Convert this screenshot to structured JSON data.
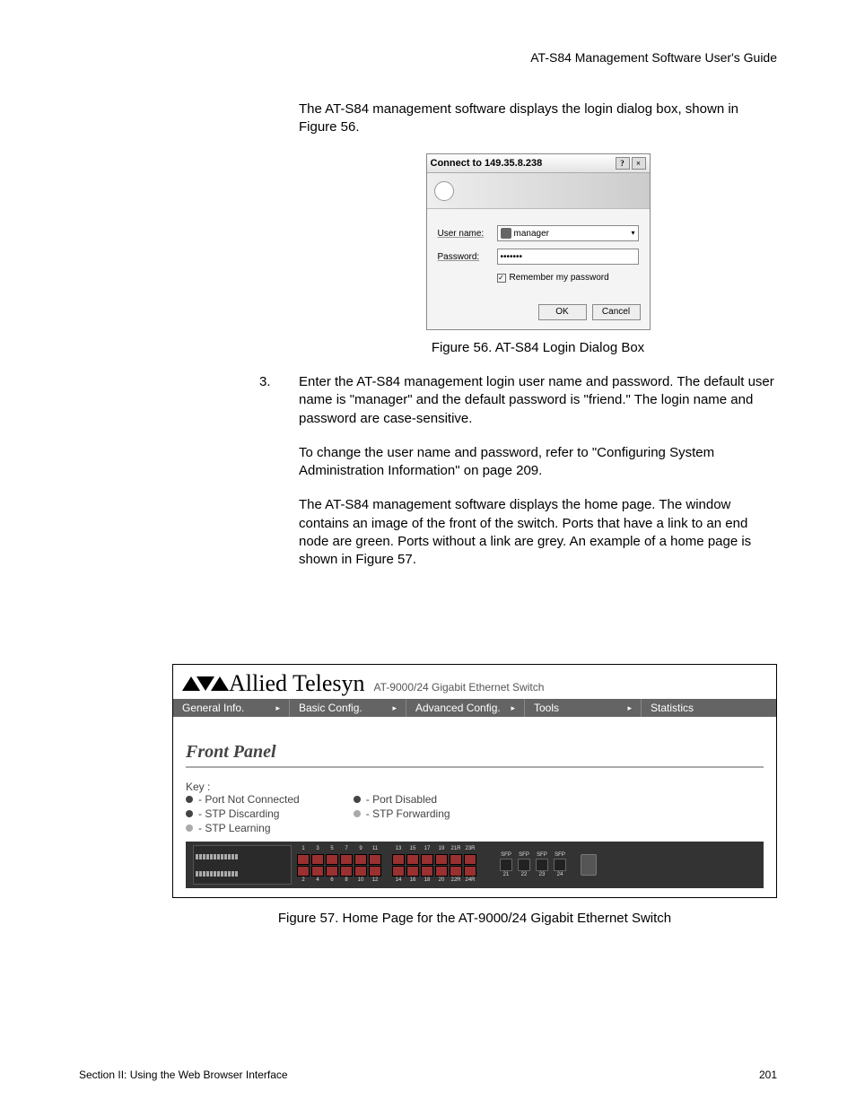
{
  "header": "AT-S84 Management Software User's Guide",
  "intro_para": "The AT-S84 management software displays the login dialog box, shown in Figure 56.",
  "dialog": {
    "title": "Connect to 149.35.8.238",
    "help_btn": "?",
    "close_btn": "×",
    "username_label": "User name:",
    "username_value": "manager",
    "password_label": "Password:",
    "password_value": "•••••••",
    "remember_label": "Remember my password",
    "ok": "OK",
    "cancel": "Cancel"
  },
  "figure56_caption": "Figure 56. AT-S84 Login Dialog Box",
  "step3_num": "3.",
  "step3_text": "Enter the AT-S84 management login user name and password. The default user name is \"manager\" and the default password is \"friend.\" The login name and password are case-sensitive.",
  "step3_para2": "To change the user name and password, refer to \"Configuring System Administration Information\" on page 209.",
  "step3_para3": "The AT-S84 management software displays the home page. The window contains an image of the front of the switch. Ports that have a link to an end node are green. Ports without a link are grey. An example of a home page is shown in Figure 57.",
  "switch": {
    "brand": "Allied Telesyn",
    "model": "AT-9000/24 Gigabit Ethernet Switch",
    "menu": {
      "general": "General Info.",
      "basic": "Basic Config.",
      "advanced": "Advanced Config.",
      "tools": "Tools",
      "stats": "Statistics"
    },
    "panel_title": "Front Panel",
    "key_label": "Key :",
    "key_items": {
      "not_connected": "- Port Not Connected",
      "stp_discarding": "- STP Discarding",
      "stp_learning": "- STP Learning",
      "port_disabled": "- Port Disabled",
      "stp_forwarding": "- STP Forwarding"
    },
    "top_nums": [
      "1",
      "3",
      "5",
      "7",
      "9",
      "11",
      "",
      "13",
      "15",
      "17",
      "19",
      "21R",
      "23R"
    ],
    "bot_nums": [
      "2",
      "4",
      "6",
      "8",
      "10",
      "12",
      "",
      "14",
      "16",
      "18",
      "20",
      "22R",
      "24R"
    ],
    "sfp_label": "SFP",
    "sfp_nums": [
      "21",
      "22",
      "23",
      "24"
    ]
  },
  "figure57_caption": "Figure 57. Home Page for the AT-9000/24 Gigabit Ethernet Switch",
  "footer_left": "Section II: Using the Web Browser Interface",
  "footer_right": "201"
}
